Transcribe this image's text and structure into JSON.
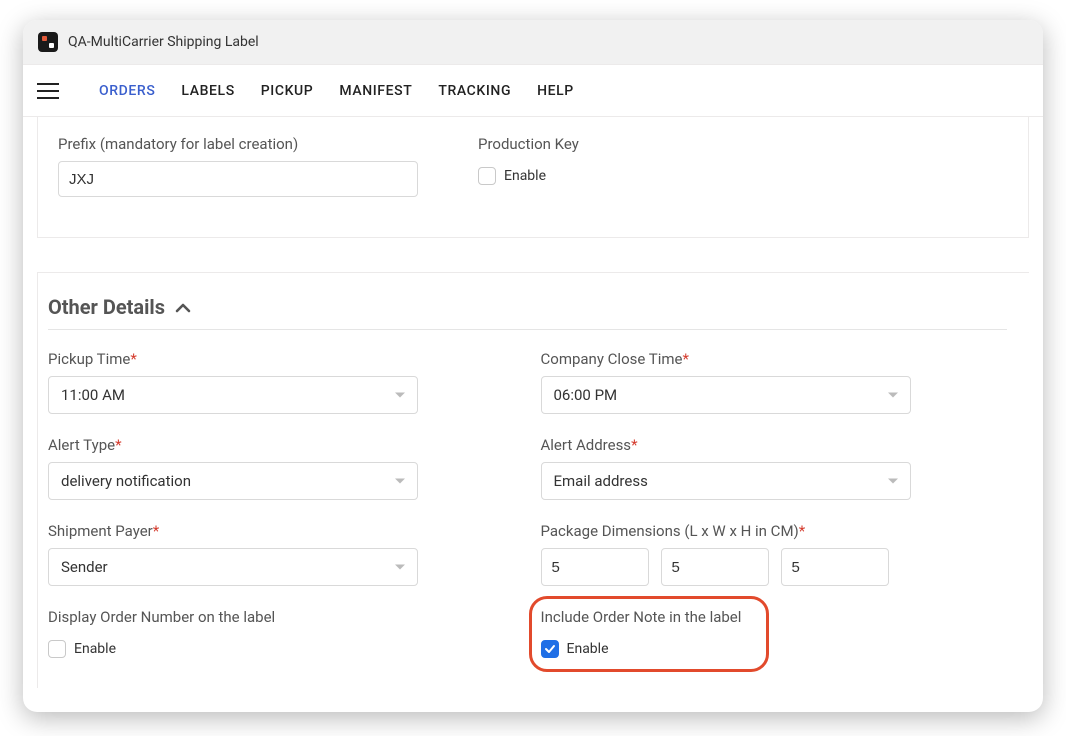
{
  "titlebar": {
    "title": "QA-MultiCarrier Shipping Label"
  },
  "nav": {
    "items": [
      {
        "label": "ORDERS",
        "active": true
      },
      {
        "label": "LABELS"
      },
      {
        "label": "PICKUP"
      },
      {
        "label": "MANIFEST"
      },
      {
        "label": "TRACKING"
      },
      {
        "label": "HELP"
      }
    ]
  },
  "top": {
    "prefix_label": "Prefix (mandatory for label creation)",
    "prefix_value": "JXJ",
    "prod_key_label": "Production Key",
    "prod_key_enable": "Enable"
  },
  "section_header": "Other Details",
  "fields": {
    "pickup_time": {
      "label": "Pickup Time",
      "value": "11:00 AM"
    },
    "close_time": {
      "label": "Company Close Time",
      "value": "06:00 PM"
    },
    "alert_type": {
      "label": "Alert Type",
      "value": "delivery notification"
    },
    "alert_addr": {
      "label": "Alert Address",
      "value": "Email address"
    },
    "ship_payer": {
      "label": "Shipment Payer",
      "value": "Sender"
    },
    "pkg_dims": {
      "label": "Package Dimensions (L x W x H in CM)",
      "l": "5",
      "w": "5",
      "h": "5"
    },
    "disp_order": {
      "label": "Display Order Number on the label",
      "enable": "Enable"
    },
    "incl_note": {
      "label": "Include Order Note in the label",
      "enable": "Enable"
    }
  }
}
